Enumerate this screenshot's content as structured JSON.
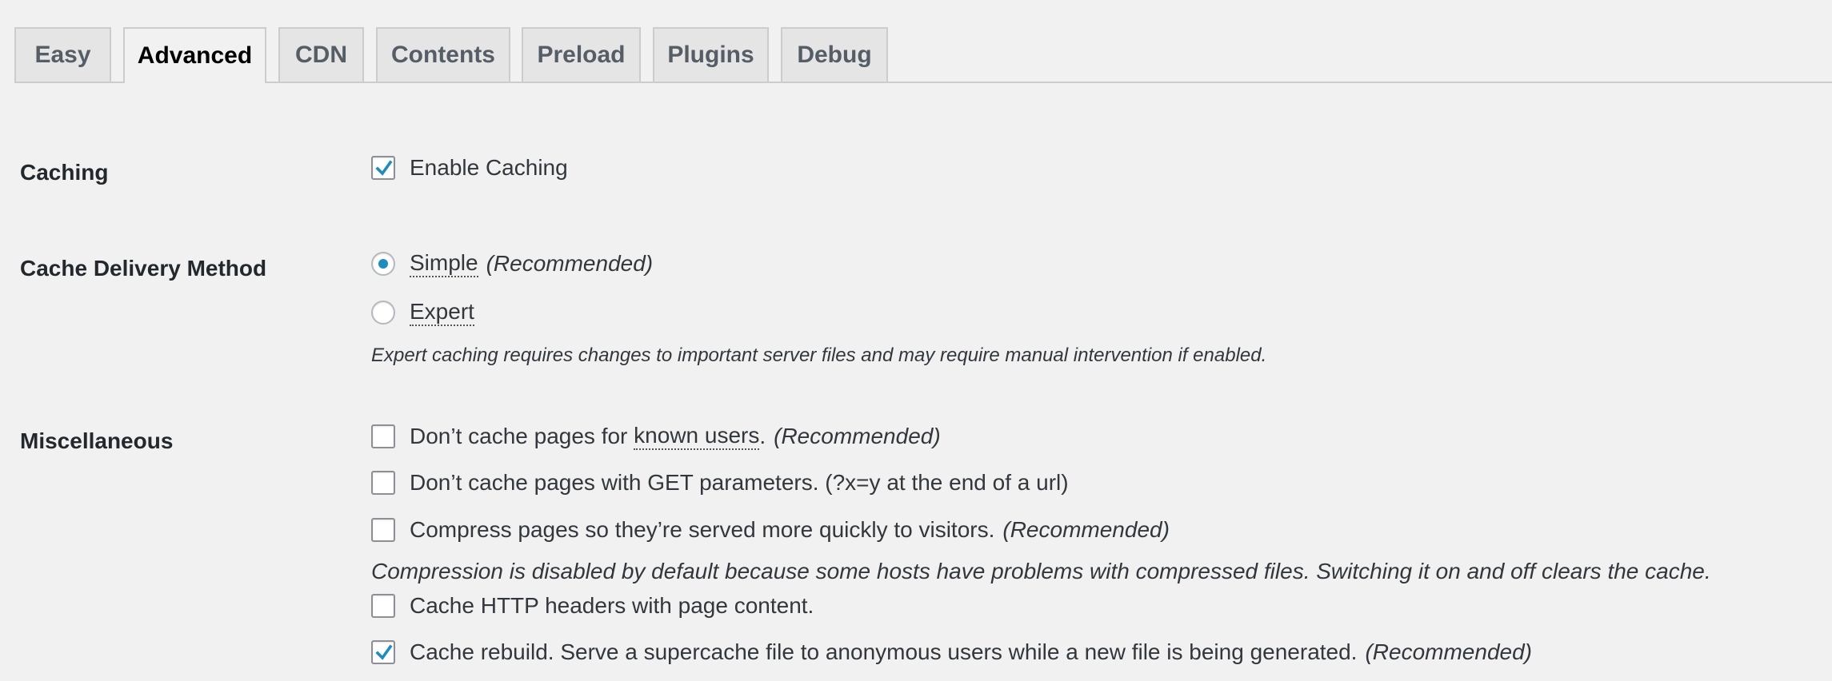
{
  "tabs": [
    {
      "label": "Easy",
      "active": false
    },
    {
      "label": "Advanced",
      "active": true
    },
    {
      "label": "CDN",
      "active": false
    },
    {
      "label": "Contents",
      "active": false
    },
    {
      "label": "Preload",
      "active": false
    },
    {
      "label": "Plugins",
      "active": false
    },
    {
      "label": "Debug",
      "active": false
    }
  ],
  "caching": {
    "label": "Caching",
    "enable_caching": {
      "label": "Enable Caching",
      "checked": true
    }
  },
  "delivery": {
    "label": "Cache Delivery Method",
    "simple": {
      "label": "Simple",
      "suffix": "(Recommended)",
      "selected": true
    },
    "expert": {
      "label": "Expert",
      "selected": false
    },
    "note": "Expert caching requires changes to important server files and may require manual intervention if enabled."
  },
  "misc": {
    "label": "Miscellaneous",
    "known_users": {
      "prefix": "Don’t cache pages for ",
      "link": "known users",
      "suffix": ".",
      "recommended": "(Recommended)",
      "checked": false
    },
    "get_params": {
      "label": "Don’t cache pages with GET parameters. (?x=y at the end of a url)",
      "checked": false
    },
    "compress": {
      "label": "Compress pages so they’re served more quickly to visitors.",
      "recommended": "(Recommended)",
      "checked": false
    },
    "compress_note": "Compression is disabled by default because some hosts have problems with compressed files. Switching it on and off clears the cache.",
    "http_headers": {
      "label": "Cache HTTP headers with page content.",
      "checked": false
    },
    "rebuild": {
      "label": "Cache rebuild. Serve a supercache file to anonymous users while a new file is being generated.",
      "recommended": "(Recommended)",
      "checked": true
    }
  },
  "colors": {
    "accent": "#1e8cbe",
    "background": "#f1f1f1",
    "tab_inactive": "#e5e5e5"
  },
  "icons": {
    "check": "checkmark-icon",
    "radio": "radio-dot-icon"
  }
}
